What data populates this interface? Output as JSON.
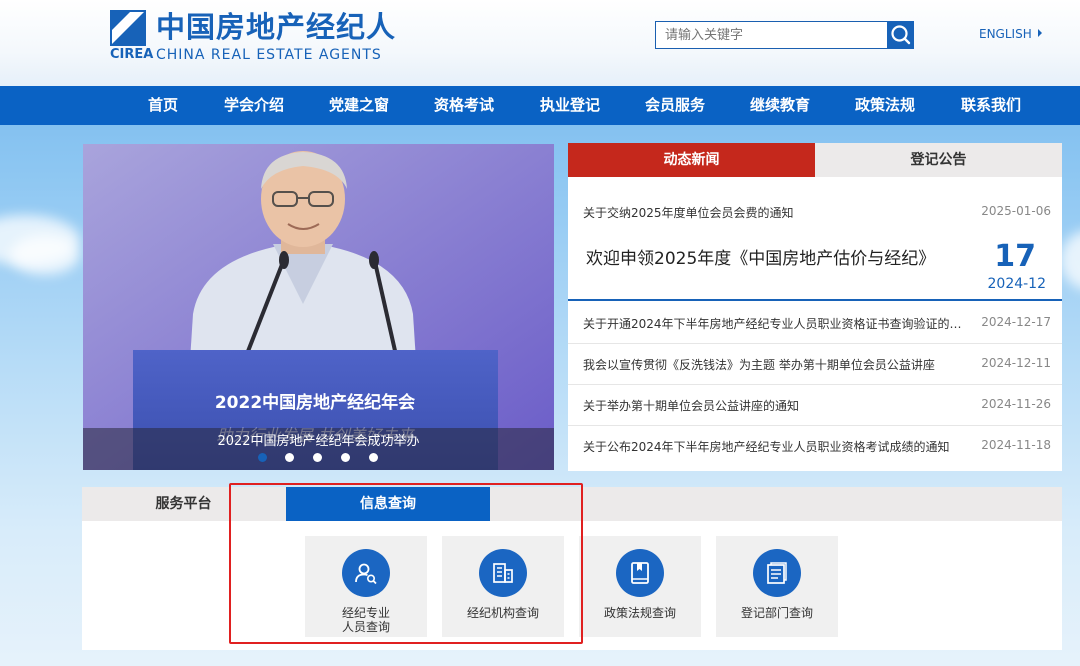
{
  "header": {
    "logo_cn": "中国房地产经纪人",
    "logo_abbr": "CIREA",
    "logo_en": "CHINA REAL ESTATE AGENTS",
    "search_placeholder": "请输入关键字",
    "search_icon": "search-icon",
    "english_label": "ENGLISH"
  },
  "nav": {
    "items": [
      "首页",
      "学会介绍",
      "党建之窗",
      "资格考试",
      "执业登记",
      "会员服务",
      "继续教育",
      "政策法规",
      "联系我们"
    ]
  },
  "banner": {
    "podium_text": "2022中国房地产经纪年会",
    "podium_slogan": "助力行业发展 共创美好未来",
    "caption": "2022中国房地产经纪年会成功举办",
    "slide_count": 5,
    "active_slide": 1
  },
  "news": {
    "tabs": [
      "动态新闻",
      "登记公告"
    ],
    "active_tab": "动态新闻",
    "top_item": {
      "title": "关于交纳2025年度单位会员会费的通知",
      "date": "2025-01-06"
    },
    "feature": {
      "title": "欢迎申领2025年度《中国房地产估价与经纪》",
      "day": "17",
      "month": "2024-12"
    },
    "items": [
      {
        "title": "关于开通2024年下半年房地产经纪专业人员职业资格证书查询验证的通知",
        "date": "2024-12-17"
      },
      {
        "title": "我会以宣传贯彻《反洗钱法》为主题 举办第十期单位会员公益讲座",
        "date": "2024-12-11"
      },
      {
        "title": "关于举办第十期单位会员公益讲座的通知",
        "date": "2024-11-26"
      },
      {
        "title": "关于公布2024年下半年房地产经纪专业人员职业资格考试成绩的通知",
        "date": "2024-11-18"
      }
    ]
  },
  "service": {
    "tabs": [
      "服务平台",
      "信息查询"
    ],
    "active_tab": "信息查询",
    "cards": [
      {
        "label_line1": "经纪专业",
        "label_line2": "人员查询",
        "icon": "person-search-icon"
      },
      {
        "label_line1": "经纪机构查询",
        "label_line2": "",
        "icon": "building-icon"
      },
      {
        "label_line1": "政策法规查询",
        "label_line2": "",
        "icon": "book-icon"
      },
      {
        "label_line1": "登记部门查询",
        "label_line2": "",
        "icon": "document-icon"
      }
    ]
  },
  "colors": {
    "brand_blue": "#1762b8",
    "nav_blue": "#0a62c4",
    "news_red": "#c5281c",
    "highlight_red": "#e02020"
  }
}
